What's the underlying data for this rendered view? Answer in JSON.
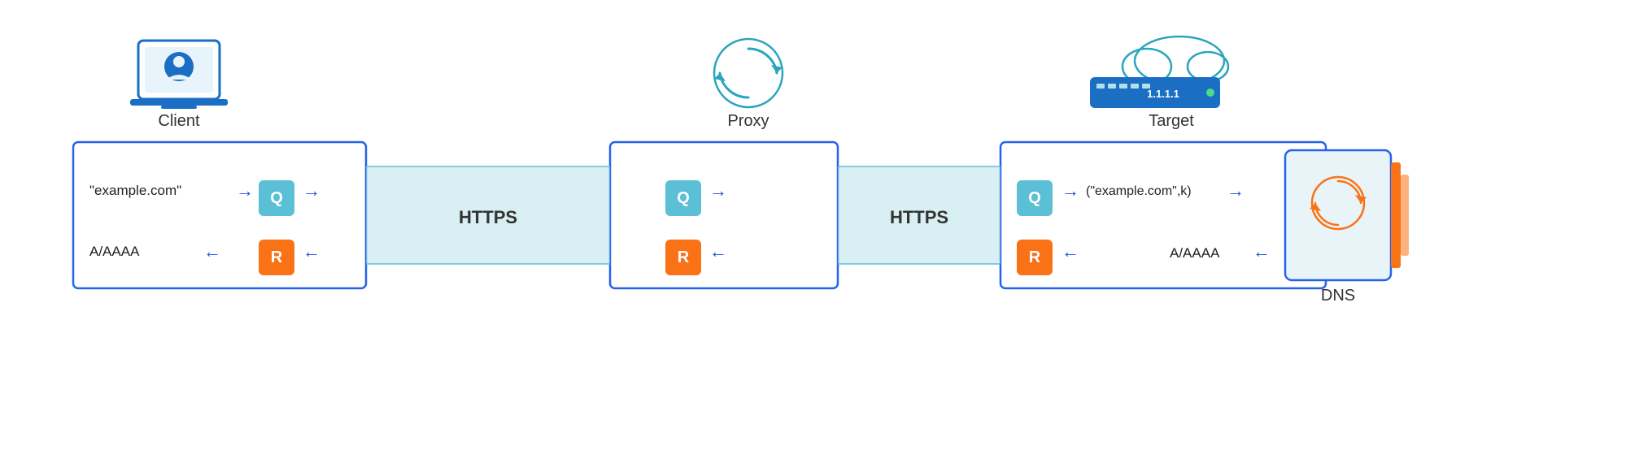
{
  "labels": {
    "client": "Client",
    "proxy": "Proxy",
    "target": "Target",
    "dns": "DNS",
    "https": "HTTPS",
    "q": "Q",
    "r": "R",
    "query_label": "\"example.com\"",
    "response_label": "A/AAAA",
    "target_query": "(\"example.com\",k)",
    "target_response": "A/AAAA"
  },
  "colors": {
    "blue_border": "#2563eb",
    "blue_arrow": "#1d4ed8",
    "teal_q": "#5bbfd6",
    "orange_r": "#f97316",
    "tunnel_bg": "#b2e0e8",
    "icon_blue": "#1a6fc4",
    "icon_teal": "#2aa5be"
  }
}
